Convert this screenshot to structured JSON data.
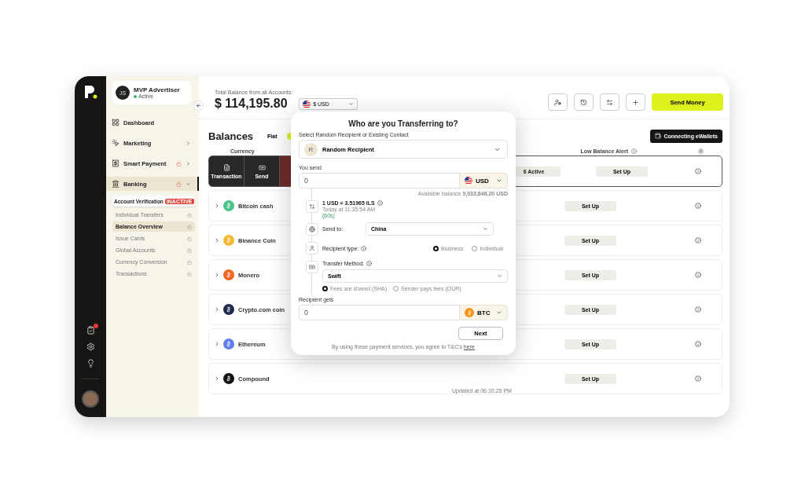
{
  "sidebar": {
    "user": {
      "initials": "JS",
      "name": "MVP Advertiser",
      "status": "Active"
    },
    "items": [
      {
        "label": "Dashboard",
        "kind": "link",
        "selected": false,
        "locked": false
      },
      {
        "label": "Marketing",
        "kind": "group",
        "selected": false,
        "locked": false,
        "expanded": false
      },
      {
        "label": "Smart Payment",
        "kind": "group",
        "selected": false,
        "locked": true,
        "expanded": false
      },
      {
        "label": "Banking",
        "kind": "group",
        "selected": true,
        "locked": true,
        "expanded": true,
        "children": [
          {
            "label": "Account Verification",
            "kind": "card",
            "badge": "INACTIVE",
            "selected": false,
            "locked": false
          },
          {
            "label": "Individual Transfers",
            "kind": "link",
            "selected": false,
            "locked": true
          },
          {
            "label": "Balance Overview",
            "kind": "link",
            "selected": true,
            "locked": true
          },
          {
            "label": "Issue Cards",
            "kind": "link",
            "selected": false,
            "locked": true
          },
          {
            "label": "Global Accounts",
            "kind": "link",
            "selected": false,
            "locked": true
          },
          {
            "label": "Currency Conversion",
            "kind": "link",
            "selected": false,
            "locked": true
          },
          {
            "label": "Transactions",
            "kind": "link",
            "selected": false,
            "locked": true
          }
        ]
      }
    ],
    "notification_dot": true
  },
  "header": {
    "total_label": "Total Balance from all Accounts:",
    "total_amount": "$ 114,195.80",
    "currency": "$ USD",
    "send_button": "Send Money"
  },
  "balances": {
    "title": "Balances",
    "tabs": [
      {
        "label": "Fiat",
        "selected": false
      }
    ],
    "connect_button": "Connecting eWallets",
    "columns": [
      "Currency",
      "Low Balance Alert"
    ],
    "rows": [
      {
        "selected": true,
        "actions": [
          {
            "label": "Transaction",
            "kind": "dark"
          },
          {
            "label": "Send",
            "kind": "dark"
          }
        ],
        "status": "6 Active",
        "alert": "Set Up"
      },
      {
        "selected": false,
        "name": "Bitcoin cash",
        "color": "#4cc38a",
        "alert": "Set Up"
      },
      {
        "selected": false,
        "name": "Binance Coin",
        "color": "#f3ba2f",
        "alert": "Set Up"
      },
      {
        "selected": false,
        "name": "Monero",
        "color": "#f26822",
        "alert": "Set Up"
      },
      {
        "selected": false,
        "name": "Crypto.com coin",
        "color": "#1f2a4a",
        "alert": "Set Up"
      },
      {
        "selected": false,
        "name": "Ethereum",
        "color": "#627eea",
        "alert": "Set Up"
      },
      {
        "selected": false,
        "name": "Compound",
        "color": "#111111",
        "alert": "Set Up",
        "updated": "Updated at 06:10:25 PM"
      }
    ]
  },
  "modal": {
    "title": "Who are you Transferring to?",
    "recipient_label": "Select Random Recipient or Existing Contact",
    "recipient_initial": "R",
    "recipient": "Random Recipient",
    "send_label": "You send",
    "send_amount": "0",
    "send_currency": "USD",
    "balance": "Available balance **9,033,846.20 USD**",
    "rate": "1 USD = 3.51965 ILS",
    "rate_time": "Today at 11:35:54 AM",
    "countdown": "(60s)",
    "send_to_label": "Send to:",
    "send_to": "China",
    "recipient_type_label": "Recipient type:",
    "recipient_types": [
      {
        "label": "Business",
        "selected": true
      },
      {
        "label": "Individual",
        "selected": false
      }
    ],
    "method_label": "Transfer Method:",
    "method": "Swift",
    "fees": [
      {
        "label": "Fees are shared (SHA)",
        "selected": true
      },
      {
        "label": "Sender pays fees (OUR)",
        "selected": false
      }
    ],
    "gets_label": "Recipient gets",
    "gets_amount": "0",
    "gets_currency": "BTC",
    "next": "Next",
    "terms": "By using these payment services, you agree to T&C's",
    "terms_link": "here"
  }
}
